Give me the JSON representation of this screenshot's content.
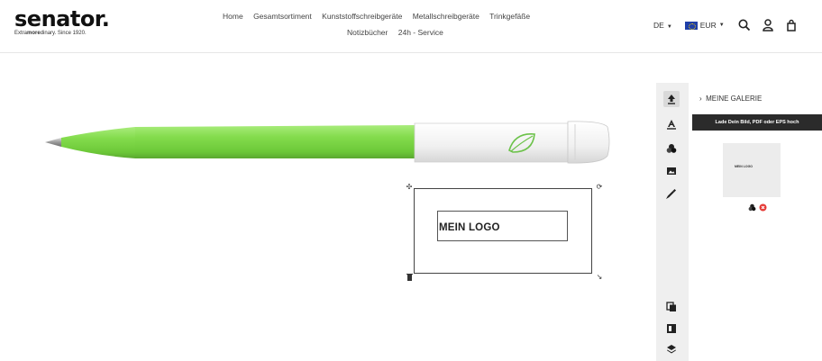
{
  "brand": {
    "name": "senator.",
    "tagline_prefix": "Extra",
    "tagline_bold": "more",
    "tagline_suffix": "dinary. Since 1920."
  },
  "nav": {
    "row1": [
      "Home",
      "Gesamtsortiment",
      "Kunststoffschreibgeräte",
      "Metallschreibgeräte",
      "Trinkgefäße"
    ],
    "row2": [
      "Notizbücher",
      "24h - Service"
    ]
  },
  "header_right": {
    "language": "DE",
    "currency": "EUR",
    "icons": [
      "search-icon",
      "account-icon",
      "cart-icon"
    ]
  },
  "canvas": {
    "logo_text": "MEIN LOGO",
    "pen_color": "#7ed957"
  },
  "tools": [
    "upload-icon",
    "text-icon",
    "shapes-icon",
    "gallery-icon",
    "pipette-icon",
    "duplicate-icon",
    "flip-icon",
    "layers-icon"
  ],
  "gallery": {
    "title": "MEINE GALERIE",
    "upload_label": "Lade Dein Bild, PDF oder EPS hoch"
  },
  "colors": {
    "accent_dark": "#2b2b2b",
    "pen_green": "#7ed957",
    "delete_red": "#e53935",
    "toolbar_bg": "#efefef"
  }
}
